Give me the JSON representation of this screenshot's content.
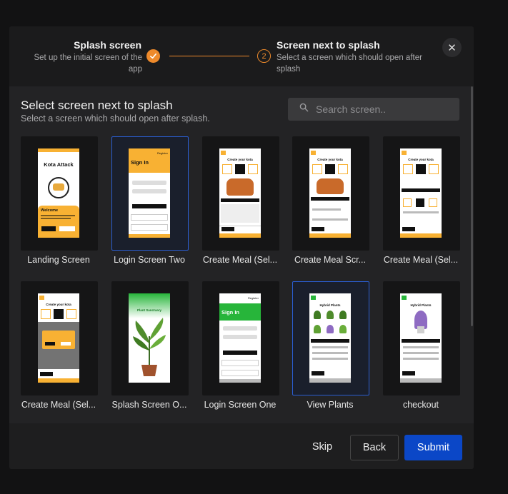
{
  "stepper": {
    "step1": {
      "title": "Splash screen",
      "description": "Set up the initial screen of the app"
    },
    "step2": {
      "number": "2",
      "title": "Screen next to splash",
      "description": "Select a screen which should open after splash"
    },
    "close_icon": "close-icon"
  },
  "section": {
    "title": "Select screen next to splash",
    "description": "Select a screen which should open after splash."
  },
  "search": {
    "placeholder": "Search screen.."
  },
  "screens": [
    {
      "label": "Landing Screen",
      "selected": false,
      "thumb_title": "Kota Attack",
      "thumb_heading": "Welcome"
    },
    {
      "label": "Login Screen Two",
      "selected": true,
      "thumb_title": "Sign In",
      "thumb_heading": "Register"
    },
    {
      "label": "Create Meal (Sel...",
      "selected": false,
      "thumb_title": "Create your kota"
    },
    {
      "label": "Create Meal Scr...",
      "selected": false,
      "thumb_title": "Create your kota"
    },
    {
      "label": "Create Meal (Sel...",
      "selected": false,
      "thumb_title": "Create your kota"
    },
    {
      "label": "Create Meal (Sel...",
      "selected": false,
      "thumb_title": "Create your kota"
    },
    {
      "label": "Splash Screen O...",
      "selected": false,
      "thumb_title": "Plant Sanctuary"
    },
    {
      "label": "Login Screen One",
      "selected": false,
      "thumb_title": "Sign In",
      "thumb_heading": "Register"
    },
    {
      "label": "View Plants",
      "selected": true,
      "thumb_title": "Hybrid Plants"
    },
    {
      "label": "checkout",
      "selected": false,
      "thumb_title": "Hybrid Plants"
    }
  ],
  "footer": {
    "skip_label": "Skip",
    "back_label": "Back",
    "submit_label": "Submit"
  },
  "colors": {
    "accent": "#ee8a2b",
    "primary": "#0b47c7",
    "selection": "#2a5ed4",
    "kota_orange": "#f8b133",
    "plant_green": "#27b53a"
  }
}
